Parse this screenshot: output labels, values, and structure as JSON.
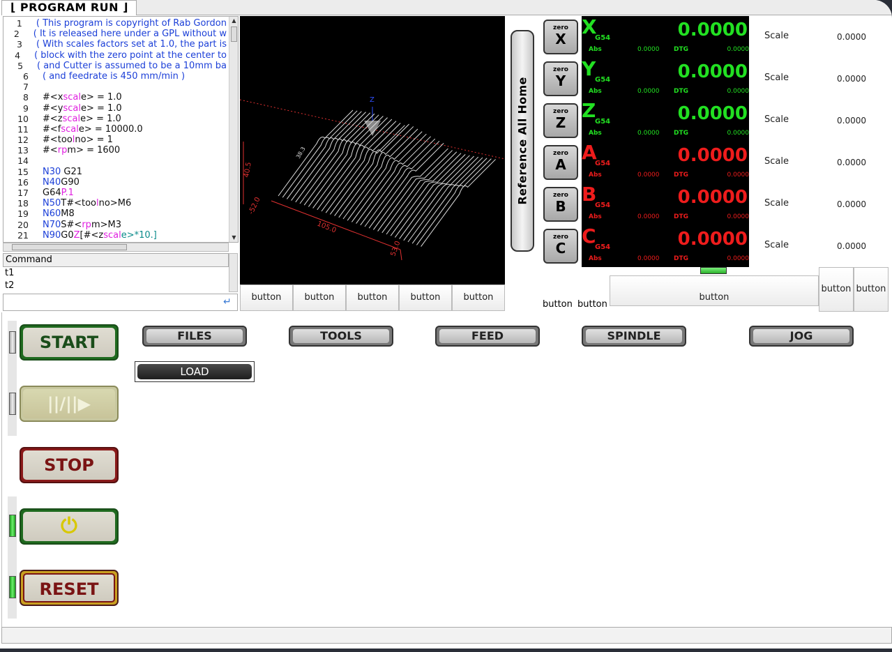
{
  "tab": {
    "label": "⌊ PROGRAM RUN ⌋"
  },
  "gcode": [
    {
      "n": "1",
      "parts": [
        {
          "t": "( This program is copyright of Rab Gordon",
          "c": "c-blue"
        }
      ]
    },
    {
      "n": "2",
      "parts": [
        {
          "t": "( It is released here under a GPL without w",
          "c": "c-blue"
        }
      ]
    },
    {
      "n": "3",
      "parts": [
        {
          "t": "( With scales factors set at 1.0, the part is",
          "c": "c-blue"
        }
      ]
    },
    {
      "n": "4",
      "parts": [
        {
          "t": "( block with the zero point at the center to",
          "c": "c-blue"
        }
      ]
    },
    {
      "n": "5",
      "parts": [
        {
          "t": "( and Cutter is assumed to be a 10mm ba",
          "c": "c-blue"
        }
      ]
    },
    {
      "n": "6",
      "parts": [
        {
          "t": "( and feedrate is 450 mm/min )",
          "c": "c-blue"
        }
      ]
    },
    {
      "n": "7",
      "parts": []
    },
    {
      "n": "8",
      "parts": [
        {
          "t": "#<x",
          "c": ""
        },
        {
          "t": "scal",
          "c": "c-mag"
        },
        {
          "t": "e> = 1.0",
          "c": ""
        }
      ]
    },
    {
      "n": "9",
      "parts": [
        {
          "t": "#<y",
          "c": ""
        },
        {
          "t": "scal",
          "c": "c-mag"
        },
        {
          "t": "e> = 1.0",
          "c": ""
        }
      ]
    },
    {
      "n": "10",
      "parts": [
        {
          "t": "#<z",
          "c": ""
        },
        {
          "t": "scal",
          "c": "c-mag"
        },
        {
          "t": "e> = 1.0",
          "c": ""
        }
      ]
    },
    {
      "n": "11",
      "parts": [
        {
          "t": "#<f",
          "c": ""
        },
        {
          "t": "scal",
          "c": "c-mag"
        },
        {
          "t": "e> = 10000.0",
          "c": ""
        }
      ]
    },
    {
      "n": "12",
      "parts": [
        {
          "t": "#<too",
          "c": ""
        },
        {
          "t": "l",
          "c": "c-mag"
        },
        {
          "t": "no> = 1",
          "c": ""
        }
      ]
    },
    {
      "n": "13",
      "parts": [
        {
          "t": "#<",
          "c": ""
        },
        {
          "t": "rp",
          "c": "c-mag"
        },
        {
          "t": "m>    = 1600",
          "c": ""
        }
      ]
    },
    {
      "n": "14",
      "parts": []
    },
    {
      "n": "15",
      "parts": [
        {
          "t": "N30",
          "c": "c-blue"
        },
        {
          "t": " G21",
          "c": ""
        }
      ]
    },
    {
      "n": "16",
      "parts": [
        {
          "t": "N40",
          "c": "c-blue"
        },
        {
          "t": "G90",
          "c": ""
        }
      ]
    },
    {
      "n": "17",
      "parts": [
        {
          "t": "G64",
          "c": ""
        },
        {
          "t": "P.1",
          "c": "c-mag"
        }
      ]
    },
    {
      "n": "18",
      "parts": [
        {
          "t": "N50",
          "c": "c-blue"
        },
        {
          "t": "T#<too",
          "c": ""
        },
        {
          "t": "l",
          "c": "c-mag"
        },
        {
          "t": "no>M6",
          "c": ""
        }
      ]
    },
    {
      "n": "19",
      "parts": [
        {
          "t": "N60",
          "c": "c-blue"
        },
        {
          "t": "M8",
          "c": ""
        }
      ]
    },
    {
      "n": "20",
      "parts": [
        {
          "t": "N70",
          "c": "c-blue"
        },
        {
          "t": "S#<",
          "c": ""
        },
        {
          "t": "rp",
          "c": "c-mag"
        },
        {
          "t": "m>M3",
          "c": ""
        }
      ]
    },
    {
      "n": "21",
      "parts": [
        {
          "t": "N90",
          "c": "c-blue"
        },
        {
          "t": "G0",
          "c": ""
        },
        {
          "t": "Z",
          "c": "c-mag"
        },
        {
          "t": "[#<z",
          "c": ""
        },
        {
          "t": "scal",
          "c": "c-mag"
        },
        {
          "t": "e>*10.]",
          "c": "c-teal"
        }
      ]
    }
  ],
  "command": {
    "header": "Command",
    "items": [
      "t1",
      "t2"
    ],
    "input_value": ""
  },
  "preview_labels": {
    "z_axis": "Z",
    "x_axis": "X",
    "y_axis": "Y",
    "dim1": "105.0",
    "dim2": "53.0",
    "dim3": "-52.0",
    "dim4": "40.5",
    "dim5": "38.3"
  },
  "preview_buttons": [
    "button",
    "button",
    "button",
    "button",
    "button"
  ],
  "ref_home": "Reference All Home",
  "axes": [
    {
      "axis": "X",
      "coord": "G54",
      "value": "0.0000",
      "abs_label": "Abs",
      "abs": "0.0000",
      "dtg_label": "DTG",
      "dtg": "0.0000",
      "color": "#22e022",
      "zero_top": "zero",
      "zero_letter": "X",
      "scale_label": "Scale",
      "scale": "0.0000"
    },
    {
      "axis": "Y",
      "coord": "G54",
      "value": "0.0000",
      "abs_label": "Abs",
      "abs": "0.0000",
      "dtg_label": "DTG",
      "dtg": "0.0000",
      "color": "#22e022",
      "zero_top": "zero",
      "zero_letter": "Y",
      "scale_label": "Scale",
      "scale": "0.0000"
    },
    {
      "axis": "Z",
      "coord": "G54",
      "value": "0.0000",
      "abs_label": "Abs",
      "abs": "0.0000",
      "dtg_label": "DTG",
      "dtg": "0.0000",
      "color": "#22e022",
      "zero_top": "zero",
      "zero_letter": "Z",
      "scale_label": "Scale",
      "scale": "0.0000"
    },
    {
      "axis": "A",
      "coord": "G54",
      "value": "0.0000",
      "abs_label": "Abs",
      "abs": "0.0000",
      "dtg_label": "DTG",
      "dtg": "0.0000",
      "color": "#ee1c1c",
      "zero_top": "zero",
      "zero_letter": "A",
      "scale_label": "Scale",
      "scale": "0.0000"
    },
    {
      "axis": "B",
      "coord": "G54",
      "value": "0.0000",
      "abs_label": "Abs",
      "abs": "0.0000",
      "dtg_label": "DTG",
      "dtg": "0.0000",
      "color": "#ee1c1c",
      "zero_top": "zero",
      "zero_letter": "B",
      "scale_label": "Scale",
      "scale": "0.0000"
    },
    {
      "axis": "C",
      "coord": "G54",
      "value": "0.0000",
      "abs_label": "Abs",
      "abs": "0.0000",
      "dtg_label": "DTG",
      "dtg": "0.0000",
      "color": "#ee1c1c",
      "zero_top": "zero",
      "zero_letter": "C",
      "scale_label": "Scale",
      "scale": "0.0000"
    }
  ],
  "right_buttons": {
    "small1": "button",
    "small2": "button",
    "wide": "button",
    "tall1": "button",
    "tall2": "button"
  },
  "controls": {
    "start": "START",
    "pause_glyph": "||/||▶",
    "stop": "STOP",
    "power_glyph": "⏻",
    "reset": "RESET"
  },
  "menu": [
    "FILES",
    "TOOLS",
    "FEED",
    "SPINDLE",
    "JOG"
  ],
  "load_button": "LOAD"
}
